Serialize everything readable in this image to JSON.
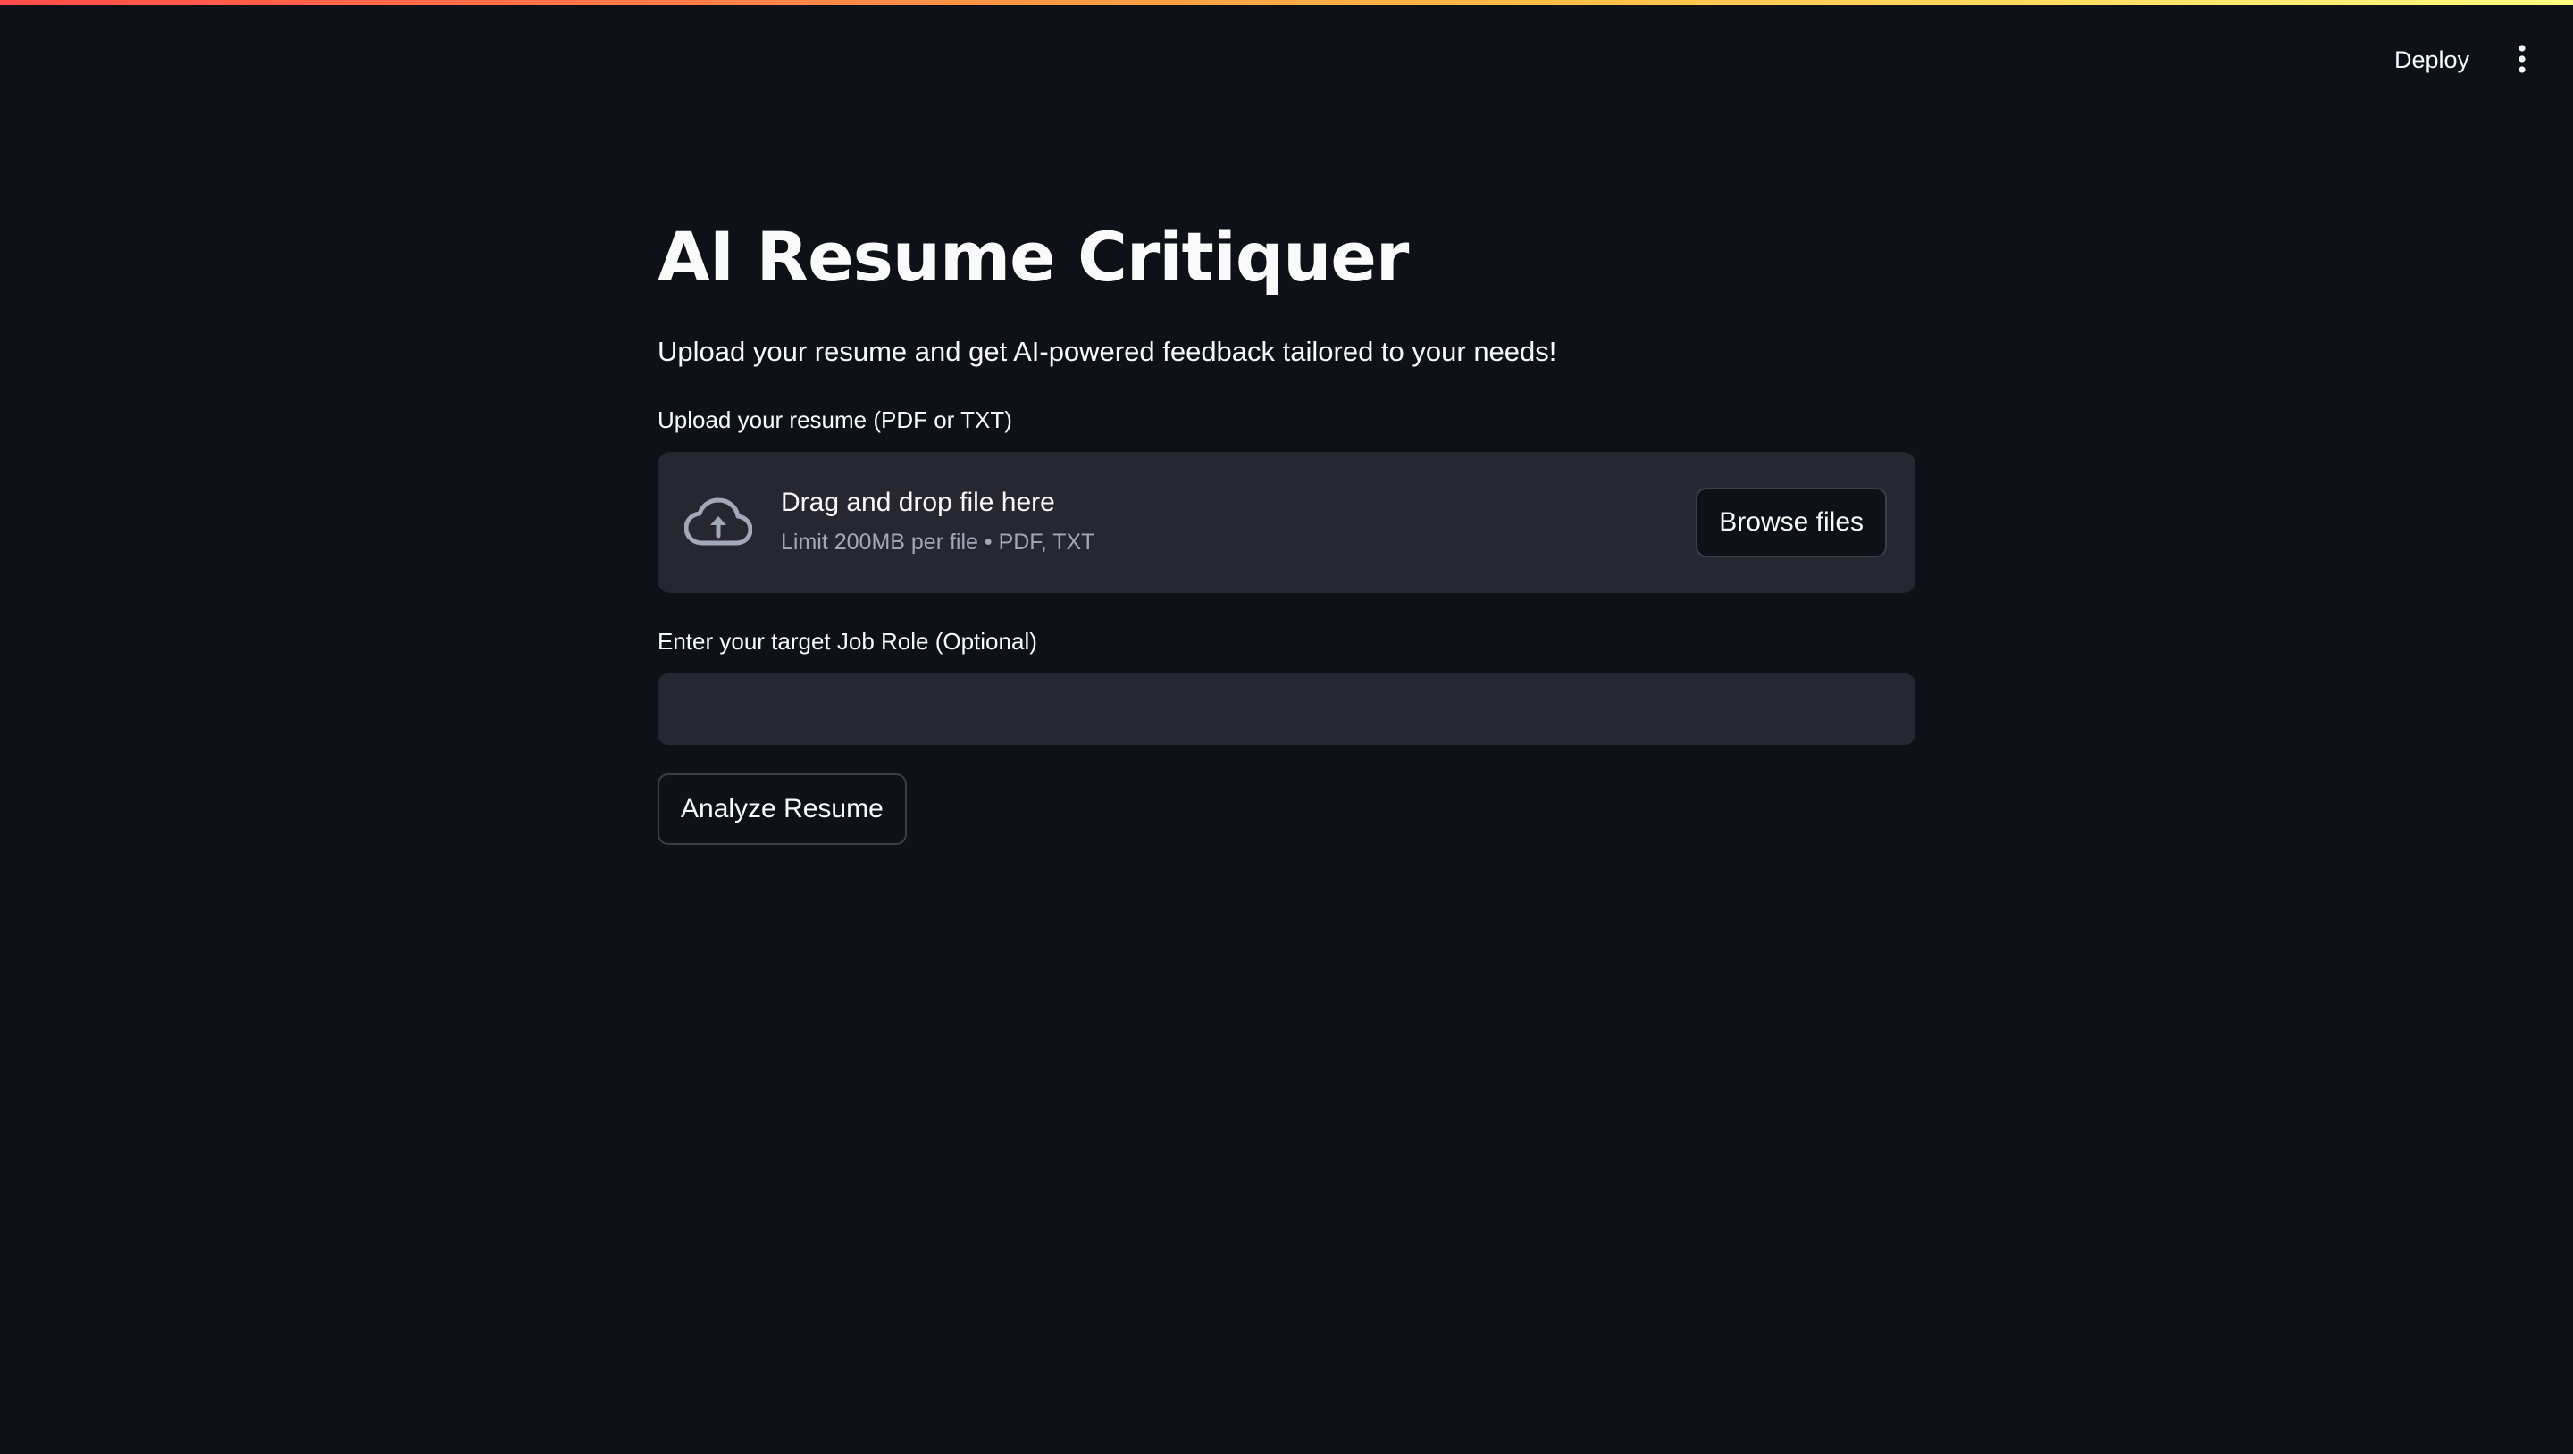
{
  "header": {
    "deploy_label": "Deploy",
    "menu_icon": "vertical-ellipsis-icon"
  },
  "main": {
    "title": "AI Resume Critiquer",
    "subtitle": "Upload your resume and get AI-powered feedback tailored to your needs!",
    "uploader": {
      "label": "Upload your resume (PDF or TXT)",
      "icon": "cloud-upload-icon",
      "dropzone_title": "Drag and drop file here",
      "dropzone_limit": "Limit 200MB per file • PDF, TXT",
      "browse_label": "Browse files"
    },
    "job_role": {
      "label": "Enter your target Job Role (Optional)",
      "value": "",
      "placeholder": ""
    },
    "analyze_label": "Analyze Resume"
  },
  "colors": {
    "background": "#0e1117",
    "surface": "#262730",
    "text": "#fafafa",
    "muted_text": "#a3a8b8",
    "accent_gradient_start": "#ff4b4b",
    "accent_gradient_end": "#fffd80"
  }
}
